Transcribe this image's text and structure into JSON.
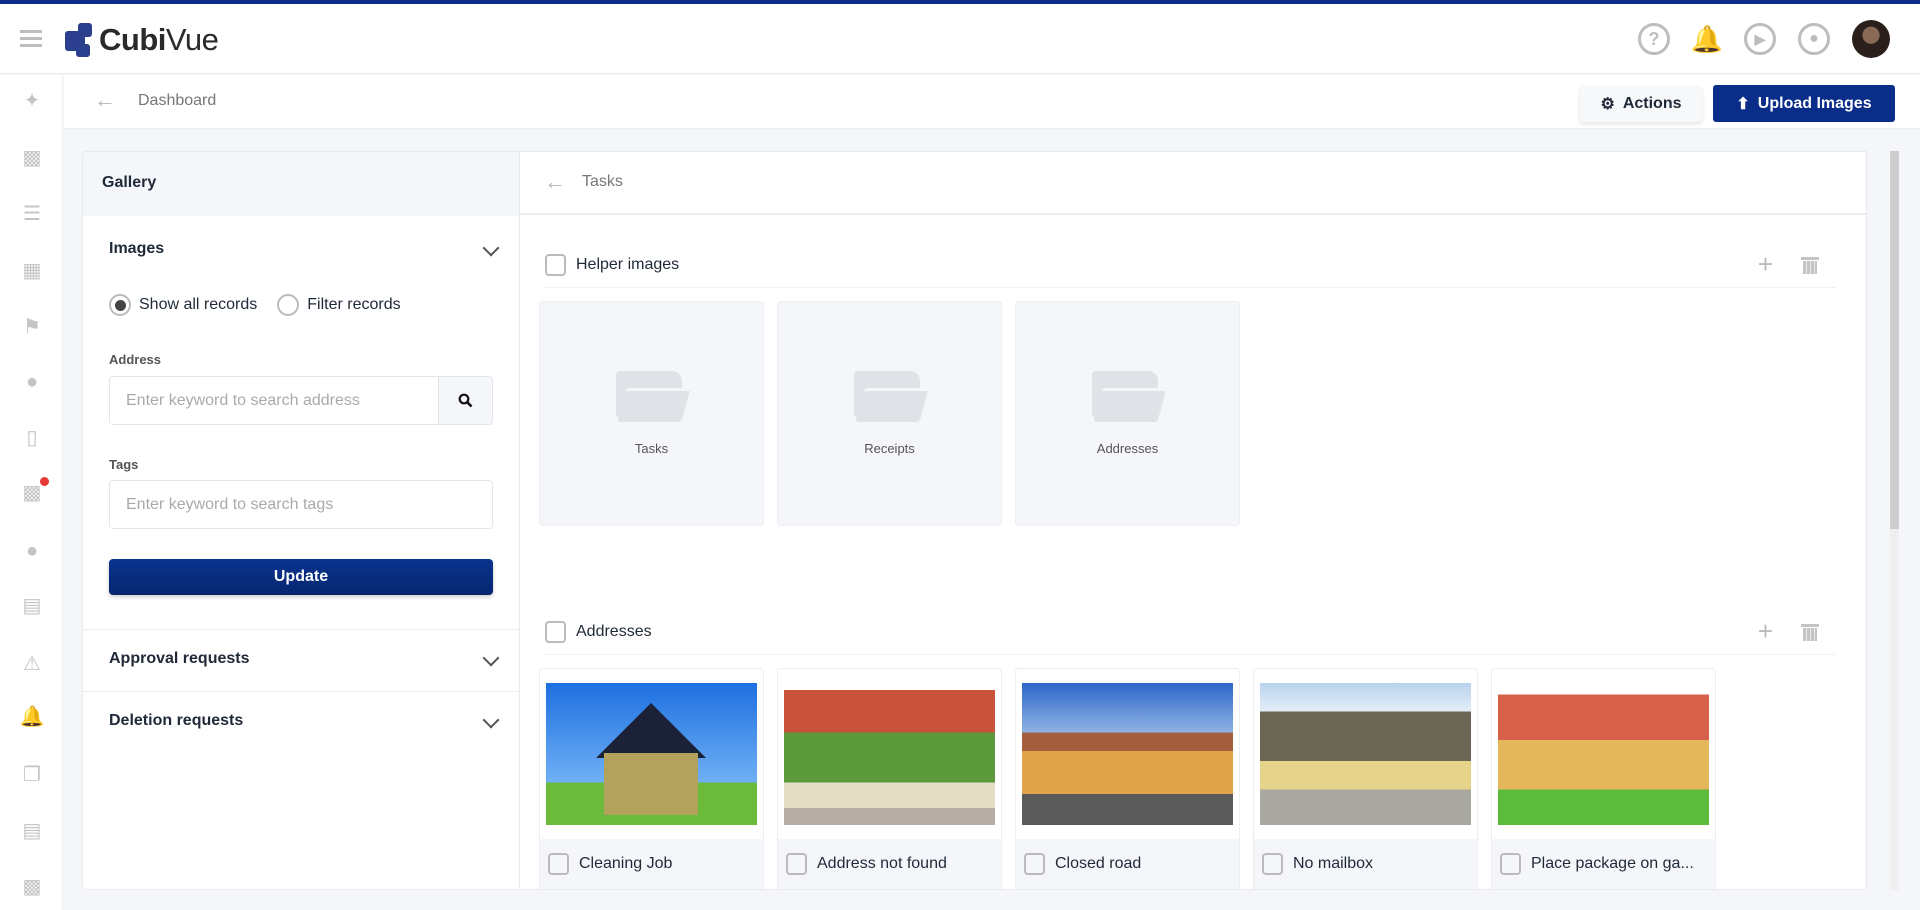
{
  "app": {
    "name_bold": "Cubi",
    "name_light": "Vue"
  },
  "header": {
    "icons": [
      "help-icon",
      "notification-bell-icon",
      "play-tutorial-icon",
      "switch-user-icon",
      "user-avatar"
    ]
  },
  "rail": {
    "icons": [
      "magic-wand-icon",
      "bar-chart-icon",
      "list-icon",
      "calendar-clock-icon",
      "map-pin-icon",
      "user-icon",
      "mobile-device-icon",
      "chat-icon",
      "user-icon-2",
      "certificate-icon",
      "warning-icon",
      "alarm-bell-icon",
      "copy-icon",
      "document-icon",
      "factory-icon"
    ],
    "chat_badge_color": "#e53935"
  },
  "breadcrumb": {
    "label": "Dashboard"
  },
  "toolbar": {
    "actions_label": "Actions",
    "upload_label": "Upload Images",
    "accent": "#0a2d8a"
  },
  "gallery": {
    "title": "Gallery",
    "images": {
      "title": "Images",
      "radio_all": "Show all records",
      "radio_filter": "Filter records",
      "selected": "Show all records",
      "address_label": "Address",
      "address_placeholder": "Enter keyword to search address",
      "address_value": "",
      "tags_label": "Tags",
      "tags_placeholder": "Enter keyword to search tags",
      "tags_value": "",
      "update_label": "Update"
    },
    "approval": "Approval requests",
    "deletion": "Deletion requests"
  },
  "main": {
    "breadcrumb": "Tasks",
    "helper": {
      "title": "Helper images",
      "folders": [
        "Tasks",
        "Receipts",
        "Addresses"
      ]
    },
    "addresses": {
      "title": "Addresses",
      "items": [
        "Cleaning Job",
        "Address not found",
        "Closed road",
        "No mailbox",
        "Place package on ga..."
      ]
    }
  }
}
